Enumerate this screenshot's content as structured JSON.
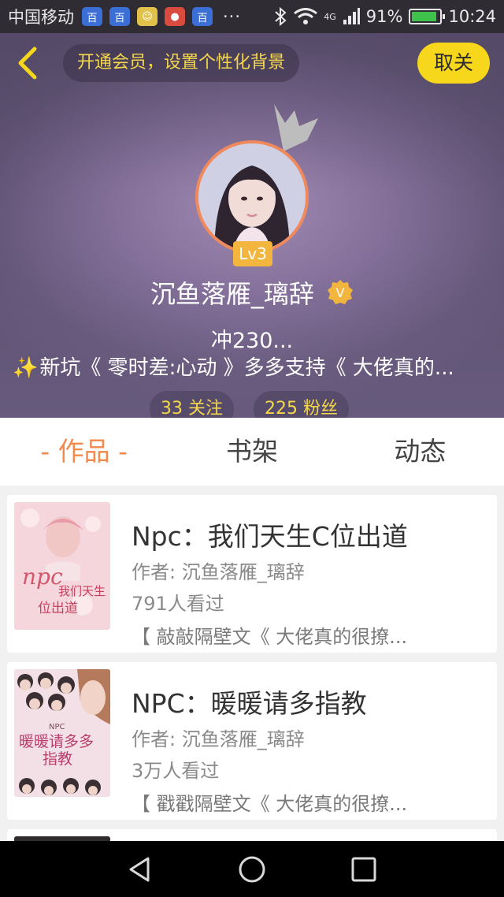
{
  "status_bar": {
    "carrier": "中国移动",
    "more": "···",
    "network": "4G",
    "battery_text": "91%",
    "battery_level": 0.91,
    "time": "10:24"
  },
  "header": {
    "member_banner": "开通会员，设置个性化背景",
    "follow_label": "取关",
    "level": "Lv3",
    "username": "沉鱼落雁_璃辞",
    "verified_label": "V",
    "signature": "冲230...",
    "intro": "新坑《 零时差:心动 》多多支持《 大佬真的...",
    "following": "33 关注",
    "followers": "225 粉丝"
  },
  "tabs": [
    {
      "label": "- 作品 -",
      "active": true
    },
    {
      "label": "书架",
      "active": false
    },
    {
      "label": "动态",
      "active": false
    }
  ],
  "works": [
    {
      "title": "Npc：我们天生C位出道",
      "author": "作者: 沉鱼落雁_璃辞",
      "views": "791人看过",
      "desc": "【 敲敲隔壁文《 大佬真的很撩..."
    },
    {
      "title": "NPC：暖暖请多指教",
      "author": "作者: 沉鱼落雁_璃辞",
      "views": "3万人看过",
      "desc": "【 戳戳隔壁文《 大佬真的很撩..."
    }
  ],
  "colors": {
    "accent": "#f18a4c",
    "follow_button": "#f7d71c",
    "level_badge": "#f2b53e",
    "member_text": "#f4d74c"
  }
}
